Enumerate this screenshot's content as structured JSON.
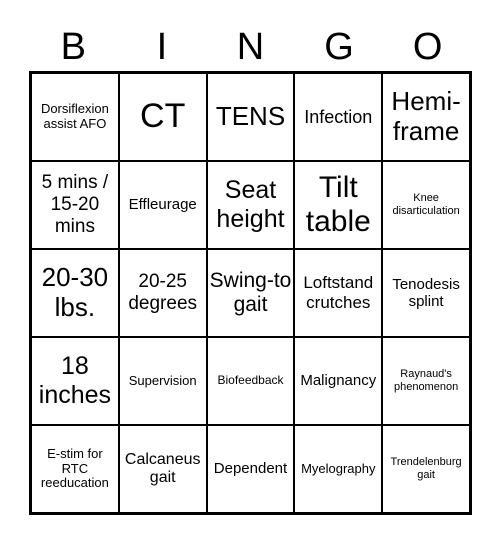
{
  "header": [
    "B",
    "I",
    "N",
    "G",
    "O"
  ],
  "cells": [
    [
      "Dorsiflexion assist AFO",
      "CT",
      "TENS",
      "Infection",
      "Hemi-frame"
    ],
    [
      "5 mins / 15-20 mins",
      "Effleurage",
      "Seat height",
      "Tilt table",
      "Knee disarticulation"
    ],
    [
      "20-30 lbs.",
      "20-25 degrees",
      "Swing-to gait",
      "Loftstand crutches",
      "Tenodesis splint"
    ],
    [
      "18 inches",
      "Supervision",
      "Biofeedback",
      "Malignancy",
      "Raynaud's phenomenon"
    ],
    [
      "E-stim for RTC reeducation",
      "Calcaneus gait",
      "Dependent",
      "Myelography",
      "Trendelenburg gait"
    ]
  ]
}
